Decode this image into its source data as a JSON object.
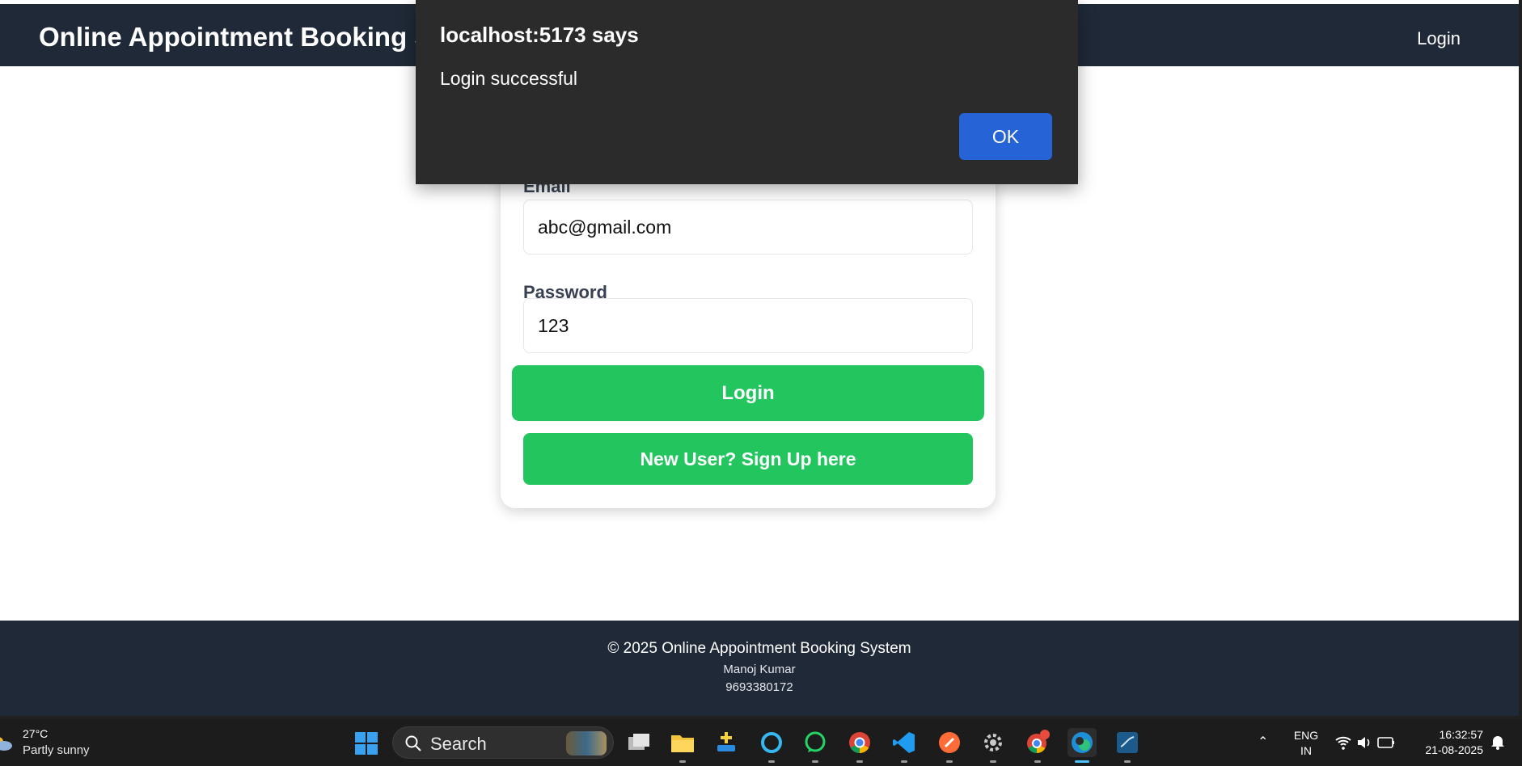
{
  "navbar": {
    "brand": "Online Appointment Booking System",
    "login_link": "Login"
  },
  "form": {
    "email_label": "Email",
    "email_value": "abc@gmail.com",
    "password_label": "Password",
    "password_value": "123",
    "login_button": "Login",
    "signup_button": "New User? Sign Up here"
  },
  "dialog": {
    "title": "localhost:5173 says",
    "message": "Login successful",
    "ok_button": "OK"
  },
  "footer": {
    "copyright": "© 2025 Online Appointment Booking System",
    "name": "Manoj Kumar",
    "phone": "9693380172"
  },
  "taskbar": {
    "weather_temp": "27°C",
    "weather_desc": "Partly sunny",
    "search_placeholder": "Search",
    "lang_line1": "ENG",
    "lang_line2": "IN",
    "time": "16:32:57",
    "date": "21-08-2025",
    "apps": [
      "task-view",
      "file-explorer",
      "app-installer",
      "cortana",
      "whatsapp",
      "chrome",
      "vscode",
      "postman",
      "settings",
      "chrome-profile",
      "edge",
      "mysql-workbench"
    ]
  },
  "colors": {
    "navbar": "#1f2937",
    "button_green": "#22c55e",
    "dialog_bg": "#2b2b2b",
    "dialog_ok": "#2563d6"
  }
}
